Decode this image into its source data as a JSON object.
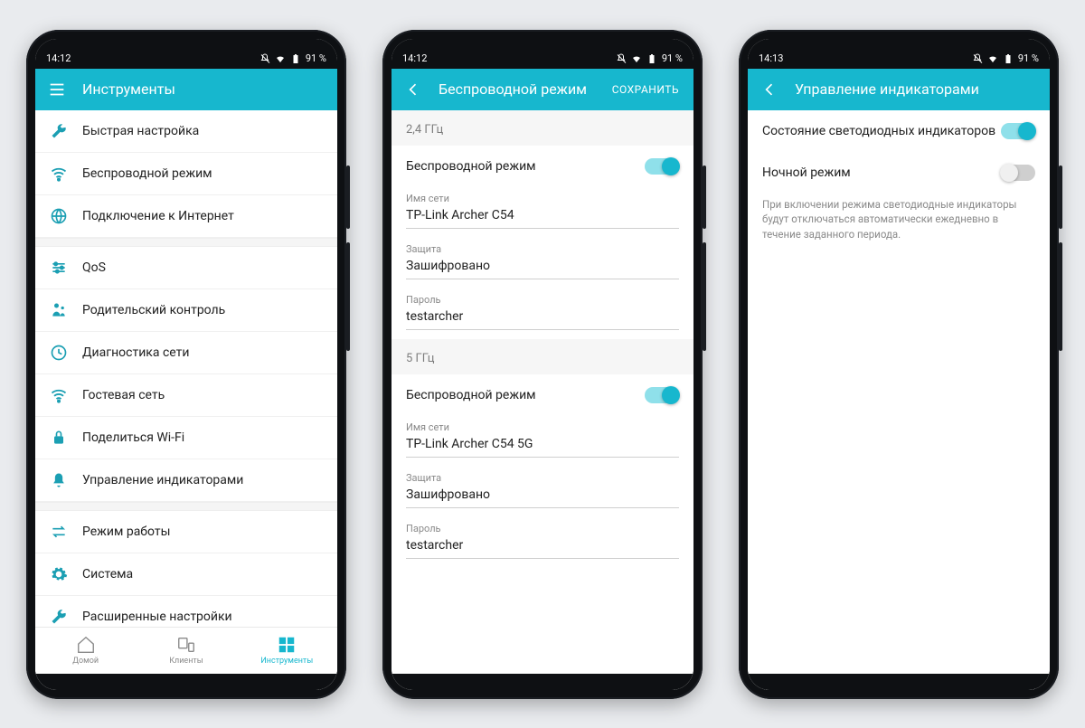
{
  "status": {
    "battery": "91 %"
  },
  "screen1": {
    "time": "14:12",
    "title": "Инструменты",
    "groups": [
      [
        "Быстрая настройка",
        "Беспроводной режим",
        "Подключение к Интернет"
      ],
      [
        "QoS",
        "Родительский контроль",
        "Диагностика сети",
        "Гостевая сеть",
        "Поделиться Wi-Fi",
        "Управление индикаторами"
      ],
      [
        "Режим работы",
        "Система",
        "Расширенные настройки"
      ]
    ],
    "tabs": [
      "Домой",
      "Клиенты",
      "Инструменты"
    ]
  },
  "screen2": {
    "time": "14:12",
    "title": "Беспроводной режим",
    "save": "СОХРАНИТЬ",
    "bands": [
      {
        "header": "2,4 ГГц",
        "wireless_label": "Беспроводной режим",
        "wireless_on": true,
        "ssid_label": "Имя сети",
        "ssid": "TP-Link Archer C54",
        "security_label": "Защита",
        "security": "Зашифровано",
        "password_label": "Пароль",
        "password": "testarcher"
      },
      {
        "header": "5 ГГц",
        "wireless_label": "Беспроводной режим",
        "wireless_on": true,
        "ssid_label": "Имя сети",
        "ssid": "TP-Link Archer C54 5G",
        "security_label": "Защита",
        "security": "Зашифровано",
        "password_label": "Пароль",
        "password": "testarcher"
      }
    ]
  },
  "screen3": {
    "time": "14:13",
    "title": "Управление индикаторами",
    "led_label": "Состояние светодиодных индикаторов",
    "led_on": true,
    "night_label": "Ночной режим",
    "night_on": false,
    "night_desc": "При включении режима светодиодные индикаторы будут отключаться автоматически ежедневно в течение заданного периода."
  },
  "icons": {
    "tools_group1": [
      "wrench-icon",
      "wifi-icon",
      "globe-icon"
    ],
    "tools_group2": [
      "sliders-icon",
      "parental-icon",
      "diagnostics-icon",
      "wifi-guest-icon",
      "share-icon",
      "bell-icon"
    ],
    "tools_group3": [
      "swap-icon",
      "gear-icon",
      "tools-icon"
    ]
  }
}
